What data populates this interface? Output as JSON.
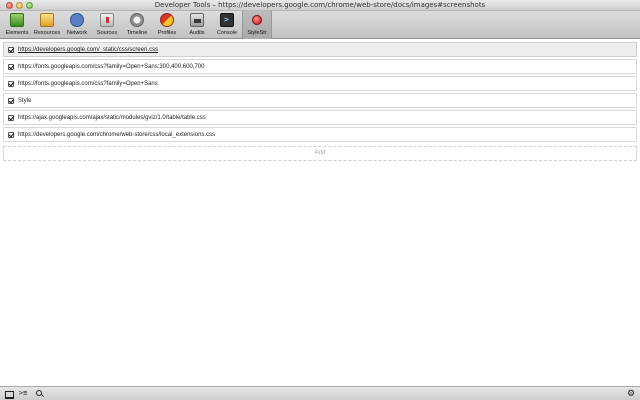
{
  "window": {
    "title": "Developer Tools – https://developers.google.com/chrome/web-store/docs/images#screenshots"
  },
  "toolbar": {
    "tabs": [
      {
        "label": "Elements",
        "icon": "elements-icon"
      },
      {
        "label": "Resources",
        "icon": "resources-icon"
      },
      {
        "label": "Network",
        "icon": "network-icon"
      },
      {
        "label": "Sources",
        "icon": "sources-icon"
      },
      {
        "label": "Timeline",
        "icon": "timeline-icon"
      },
      {
        "label": "Profiles",
        "icon": "profiles-icon"
      },
      {
        "label": "Audits",
        "icon": "audits-icon"
      },
      {
        "label": "Console",
        "icon": "console-icon"
      },
      {
        "label": "StyleStr",
        "icon": "stylestr-icon",
        "active": true
      }
    ]
  },
  "stylesheets": [
    {
      "checked": true,
      "label": "https://developers.google.com/_static/css/screen.css"
    },
    {
      "checked": true,
      "label": "https://fonts.googleapis.com/css?family=Open+Sans:300,400,600,700"
    },
    {
      "checked": true,
      "label": "https://fonts.googleapis.com/css?family=Open+Sans"
    },
    {
      "checked": true,
      "label": "Style"
    },
    {
      "checked": true,
      "label": "https://ajax.googleapis.com/ajax/static/modules/gviz/1.0/table/table.css"
    },
    {
      "checked": true,
      "label": "https://developers.google.com/chrome/web-store/css/local_extensions.css"
    }
  ],
  "add_label": "Add",
  "statusbar": {
    "console_glyph": ">≡"
  },
  "colors": {
    "toolbar_bg": "#c9c9c9",
    "selected_row_bg": "#eeeeee",
    "add_text": "#a5a5a5"
  }
}
